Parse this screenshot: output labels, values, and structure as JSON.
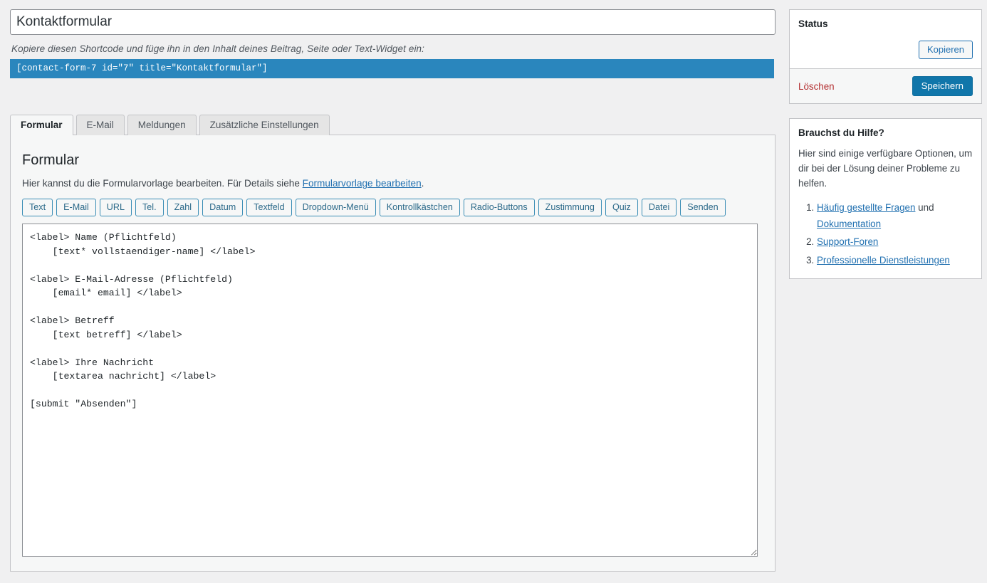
{
  "form_title": {
    "value": "Kontaktformular"
  },
  "shortcode": {
    "hint": "Kopiere diesen Shortcode und füge ihn in den Inhalt deines Beitrag, Seite oder Text-Widget ein:",
    "code": "[contact-form-7 id=\"7\" title=\"Kontaktformular\"]"
  },
  "tabs": [
    {
      "label": "Formular",
      "active": true
    },
    {
      "label": "E-Mail",
      "active": false
    },
    {
      "label": "Meldungen",
      "active": false
    },
    {
      "label": "Zusätzliche Einstellungen",
      "active": false
    }
  ],
  "panel": {
    "heading": "Formular",
    "description_prefix": "Hier kannst du die Formularvorlage bearbeiten. Für Details siehe ",
    "description_link": "Formularvorlage bearbeiten",
    "description_suffix": "."
  },
  "tag_buttons": [
    "Text",
    "E-Mail",
    "URL",
    "Tel.",
    "Zahl",
    "Datum",
    "Textfeld",
    "Dropdown-Menü",
    "Kontrollkästchen",
    "Radio-Buttons",
    "Zustimmung",
    "Quiz",
    "Datei",
    "Senden"
  ],
  "editor": {
    "content": "<label> Name (Pflichtfeld)\n    [text* vollstaendiger-name] </label>\n\n<label> E-Mail-Adresse (Pflichtfeld)\n    [email* email] </label>\n\n<label> Betreff\n    [text betreff] </label>\n\n<label> Ihre Nachricht\n    [textarea nachricht] </label>\n\n[submit \"Absenden\"]"
  },
  "status_box": {
    "title": "Status",
    "copy_label": "Kopieren",
    "delete_label": "Löschen",
    "save_label": "Speichern"
  },
  "help_box": {
    "title": "Brauchst du Hilfe?",
    "paragraph": "Hier sind einige verfügbare Optionen, um dir bei der Lösung deiner Probleme zu helfen.",
    "items": [
      {
        "link": "Häufig gestellte Fragen",
        "suffix": " und ",
        "link2": "Dokumentation"
      },
      {
        "link": "Support-Foren",
        "suffix": "",
        "link2": ""
      },
      {
        "link": "Professionelle Dienstleistungen",
        "suffix": "",
        "link2": ""
      }
    ]
  },
  "colors": {
    "page_bg": "#f0f0f1",
    "panel_bg": "#f6f7f7",
    "shortcode_bg": "#2a86bd",
    "primary_button": "#1076aa",
    "link": "#2271b1",
    "delete": "#b32d2e",
    "tag_border": "#3a8db5"
  }
}
